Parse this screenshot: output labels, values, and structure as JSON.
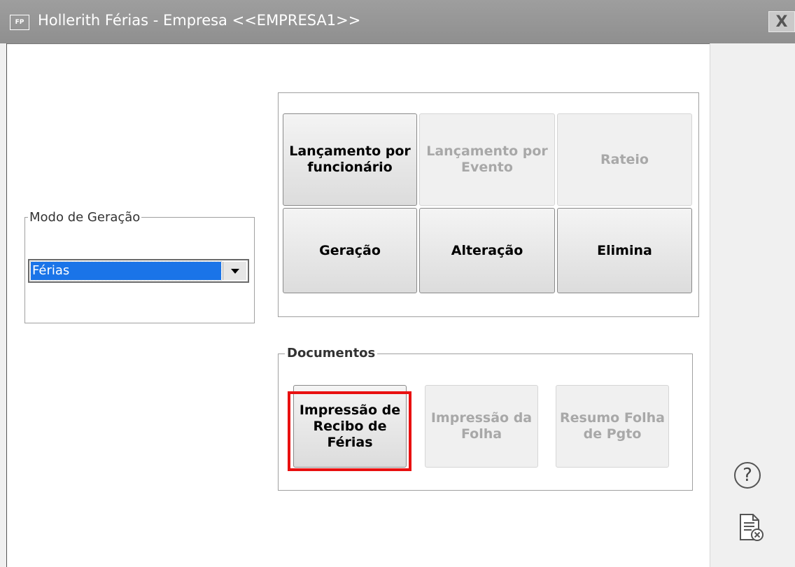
{
  "window": {
    "app_icon_text": "FP",
    "title": "Hollerith Férias - Empresa <<EMPRESA1>>",
    "close_label": "X"
  },
  "modo_geracao": {
    "legend": "Modo de Geração",
    "selected_value": "Férias"
  },
  "actions": {
    "lancamento_funcionario": "Lançamento por funcionário",
    "lancamento_evento": "Lançamento por Evento",
    "rateio": "Rateio",
    "geracao": "Geração",
    "alteracao": "Alteração",
    "elimina": "Elimina"
  },
  "documentos": {
    "legend": "Documentos",
    "impressao_recibo": "Impressão de Recibo de Férias",
    "impressao_folha": "Impressão da Folha",
    "resumo_folha": "Resumo Folha de Pgto"
  },
  "side": {
    "help_glyph": "?"
  },
  "colors": {
    "title_bar": "#9e9e9e",
    "selection": "#1a74e8",
    "highlight": "#e81010",
    "disabled_text": "#a8a8a8"
  }
}
